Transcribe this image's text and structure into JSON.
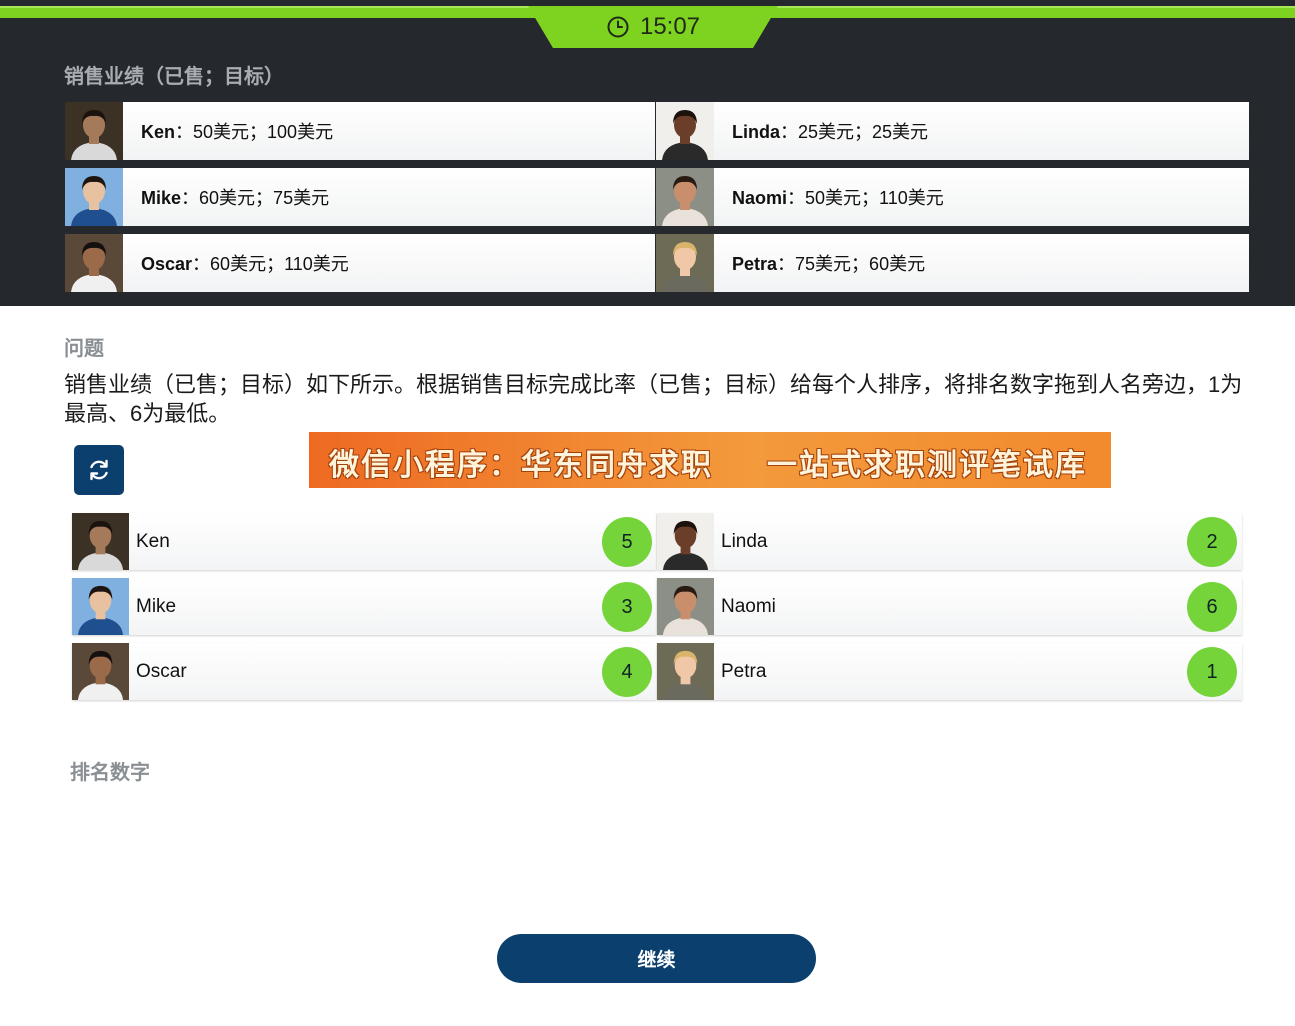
{
  "timer": {
    "value": "15:07",
    "icon": "clock-icon"
  },
  "performance": {
    "title": "销售业绩（已售；目标）",
    "rows": [
      {
        "left": {
          "name": "Ken",
          "detail": "：50美元；100美元",
          "avatar_bg": "#3b3124",
          "skin": "#a47a5a",
          "hair": "#1b130e",
          "shirt": "#d9d9d9"
        },
        "right": {
          "name": "Linda",
          "detail": "：25美元；25美元",
          "avatar_bg": "#f0efeb",
          "skin": "#6b3e2a",
          "hair": "#1c110b",
          "shirt": "#2a2a2a"
        }
      },
      {
        "left": {
          "name": "Mike",
          "detail": "：60美元；75美元",
          "avatar_bg": "#7fb0e0",
          "skin": "#e8c1a0",
          "hair": "#1e1510",
          "shirt": "#1f4f8f"
        },
        "right": {
          "name": "Naomi",
          "detail": "：50美元；110美元",
          "avatar_bg": "#8b8f86",
          "skin": "#c98f6d",
          "hair": "#2a1b12",
          "shirt": "#e8e2da"
        }
      },
      {
        "left": {
          "name": "Oscar",
          "detail": "：60美元；110美元",
          "avatar_bg": "#5a4838",
          "skin": "#9b6a48",
          "hair": "#151010",
          "shirt": "#f0f0f0"
        },
        "right": {
          "name": "Petra",
          "detail": "：75美元；60美元",
          "avatar_bg": "#6d6a55",
          "skin": "#f0c8a8",
          "hair": "#d9b46a",
          "shirt": "#6b6a5e"
        }
      }
    ]
  },
  "question": {
    "title": "问题",
    "text": "销售业绩（已售；目标）如下所示。根据销售目标完成比率（已售；目标）给每个人排序，将排名数字拖到人名旁边，1为最高、6为最低。"
  },
  "reset_button": {
    "icon": "refresh-icon"
  },
  "banner": {
    "part1": "微信小程序：华东同舟求职",
    "part2": "一站式求职测评笔试库"
  },
  "ranking": {
    "rows": [
      {
        "left": {
          "name": "Ken",
          "rank": "5"
        },
        "right": {
          "name": "Linda",
          "rank": "2"
        }
      },
      {
        "left": {
          "name": "Mike",
          "rank": "3"
        },
        "right": {
          "name": "Naomi",
          "rank": "6"
        }
      },
      {
        "left": {
          "name": "Oscar",
          "rank": "4"
        },
        "right": {
          "name": "Petra",
          "rank": "1"
        }
      }
    ]
  },
  "rank_numbers": {
    "title": "排名数字"
  },
  "continue_button": {
    "label": "继续"
  },
  "colors": {
    "accent_green": "#7ed321",
    "navy": "#0b3f6d",
    "badge_green": "#74d43a",
    "banner_orange": "#ee6a22"
  }
}
